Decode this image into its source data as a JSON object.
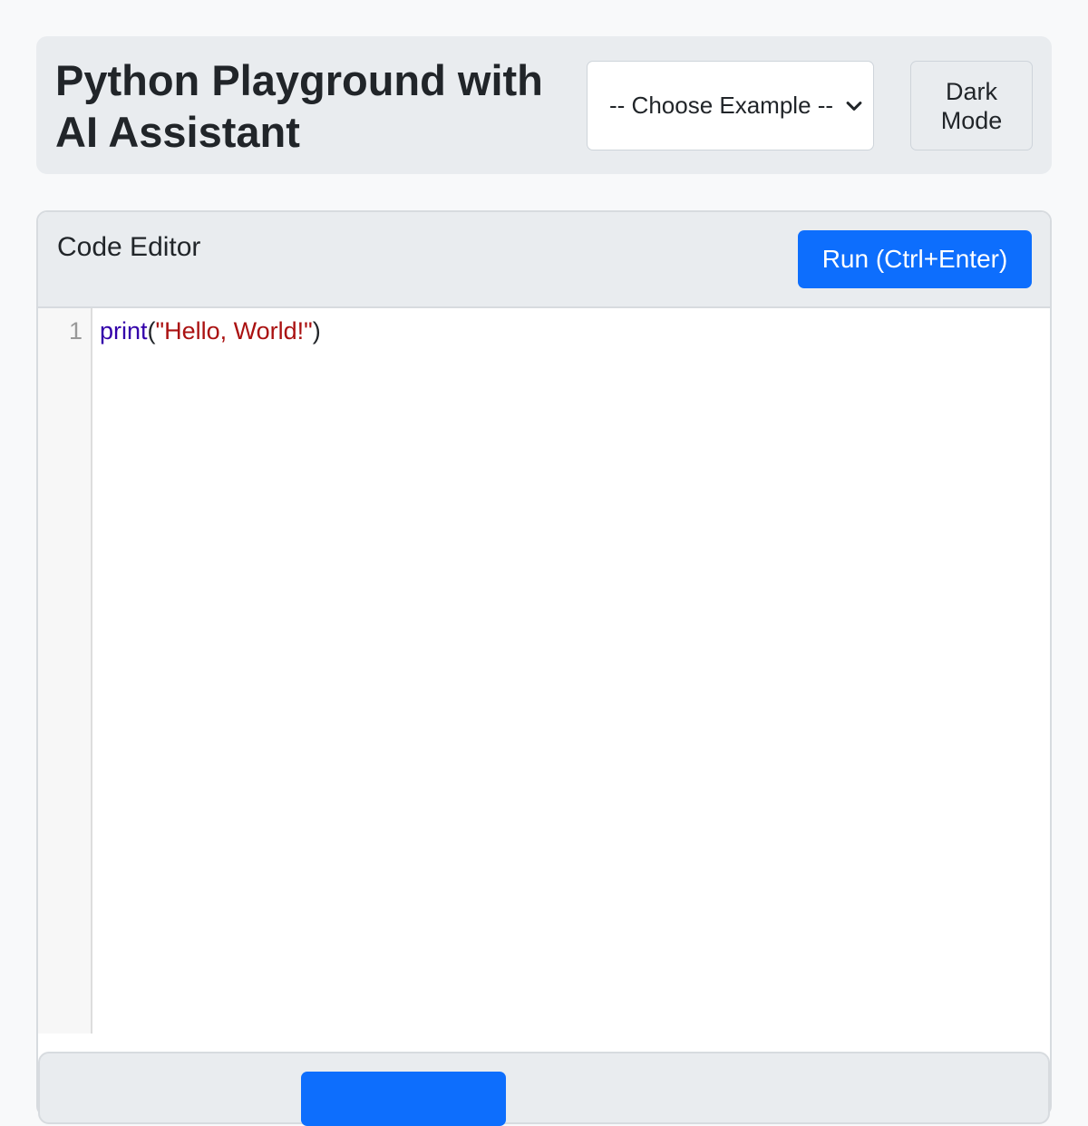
{
  "header": {
    "title": "Python Playground with AI Assistant",
    "example_select": {
      "selected": "-- Choose Example --"
    },
    "dark_mode_label": "Dark Mode"
  },
  "editor": {
    "title": "Code Editor",
    "run_label": "Run (Ctrl+Enter)",
    "lines": [
      {
        "number": "1",
        "fn": "print",
        "open": "(",
        "str": "\"Hello, World!\"",
        "close": ")"
      }
    ]
  },
  "colors": {
    "accent": "#0d6efd",
    "header_bg": "#e9ecef",
    "page_bg": "#f8f9fa",
    "code_function": "#3300aa",
    "code_string": "#aa1111"
  },
  "icons": {
    "select_arrow": "chevron-down-icon"
  }
}
